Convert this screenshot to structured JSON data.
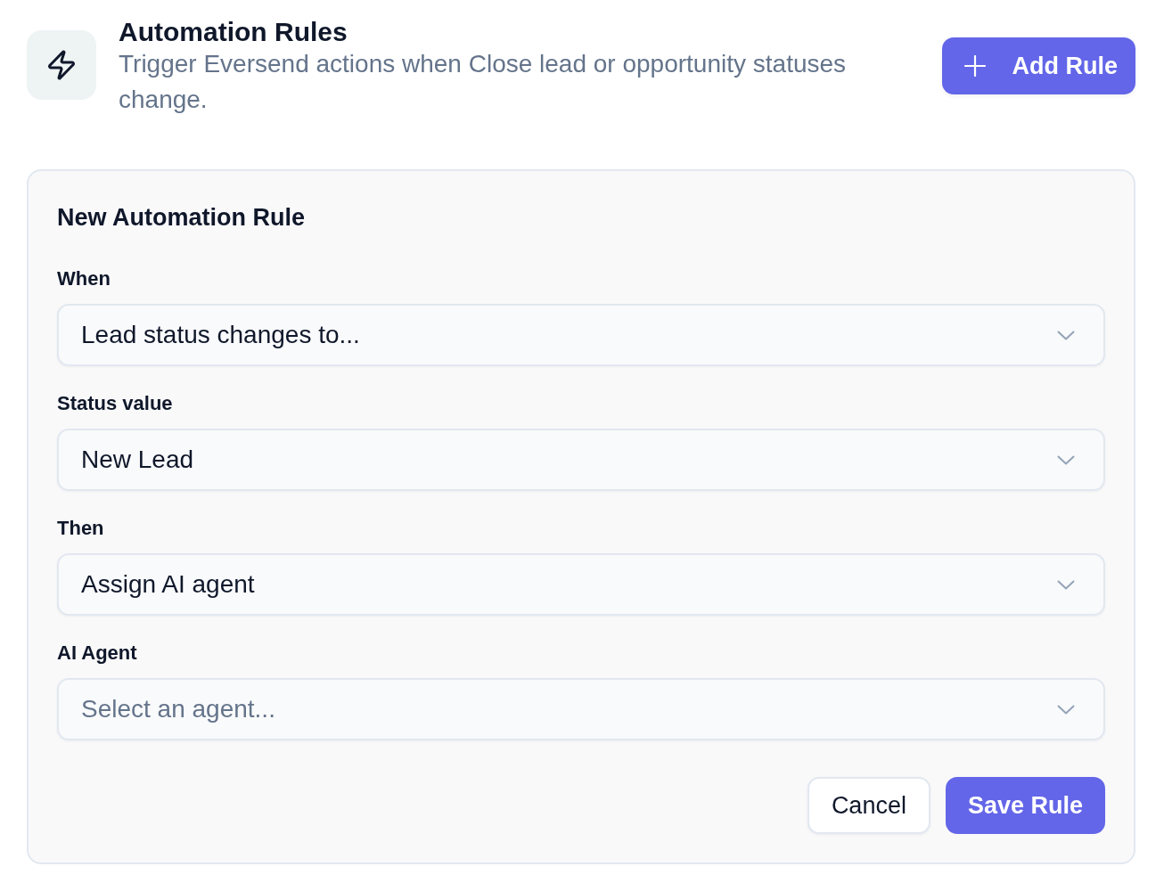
{
  "header": {
    "title": "Automation Rules",
    "subtitle": "Trigger Eversend actions when Close lead or opportunity statuses change.",
    "add_button": {
      "label": "Add Rule"
    }
  },
  "form": {
    "title": "New Automation Rule",
    "fields": [
      {
        "label": "When",
        "value": "Lead status changes to..."
      },
      {
        "label": "Status value",
        "value": "New Lead"
      },
      {
        "label": "Then",
        "value": "Assign AI agent"
      },
      {
        "label": "AI Agent",
        "placeholder": "Select an agent..."
      }
    ],
    "buttons": [
      {
        "label": "Cancel",
        "kind": "secondary"
      },
      {
        "label": "Save Rule",
        "kind": "primary"
      }
    ]
  }
}
